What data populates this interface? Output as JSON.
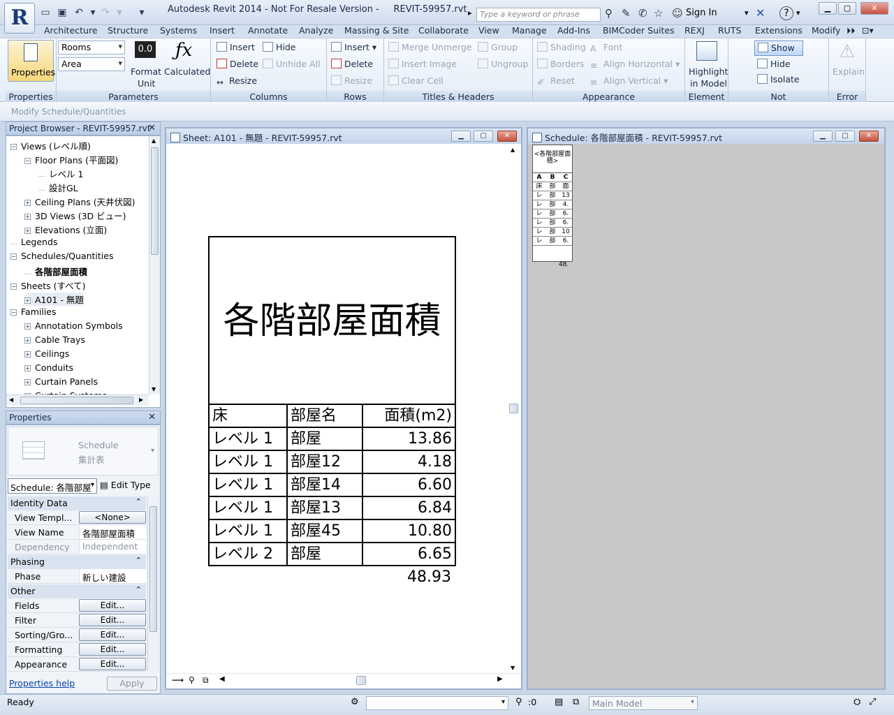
{
  "title": {
    "app": "Autodesk Revit 2014 - Not For Resale Version -",
    "file": "REVIT-59957.rvt"
  },
  "search": {
    "placeholder": "Type a keyword or phrase"
  },
  "signin": "Sign In",
  "ribbon_tabs": [
    "Architecture",
    "Structure",
    "Systems",
    "Insert",
    "Annotate",
    "Analyze",
    "Massing & Site",
    "Collaborate",
    "View",
    "Manage",
    "Add-Ins",
    "BIMCoder Suites",
    "REXJ",
    "RUTS",
    "Extensions",
    "Modify"
  ],
  "ribbon": {
    "properties": {
      "button": "Properties",
      "label": "Properties"
    },
    "parameters": {
      "label": "Parameters",
      "combo1": "Rooms",
      "combo2": "Area",
      "format_unit_icon": "0.0",
      "format_unit": "Format",
      "format_unit2": "Unit",
      "calculated": "Calculated"
    },
    "columns": {
      "label": "Columns",
      "insert": "Insert",
      "hide": "Hide",
      "delete": "Delete",
      "unhide": "Unhide  All",
      "resize": "Resize"
    },
    "rows": {
      "label": "Rows",
      "insert": "Insert",
      "delete": "Delete",
      "resize": "Resize"
    },
    "titles": {
      "label": "Titles & Headers",
      "merge": "Merge  Unmerge",
      "group": "Group",
      "insert_image": "Insert  Image",
      "ungroup": "Ungroup",
      "clear_cell": "Clear  Cell"
    },
    "appearance": {
      "label": "Appearance",
      "shading": "Shading",
      "font": "Font",
      "borders": "Borders",
      "align_h": "Align  Horizontal",
      "reset": "Reset",
      "align_v": "Align  Vertical"
    },
    "element": {
      "label": "Element",
      "highlight": "Highlight",
      "in_model": "in Model"
    },
    "not_placed": {
      "label": "Not Placed/Unenclosed",
      "show": "Show",
      "hide": "Hide",
      "isolate": "Isolate"
    },
    "error": {
      "label": "Error",
      "explain": "Explain"
    }
  },
  "context": "Modify Schedule/Quantities",
  "browser": {
    "title": "Project Browser - REVIT-59957.rvt",
    "items": [
      {
        "text": "Views (レベル順)",
        "level": 0,
        "toggle": "−"
      },
      {
        "text": "Floor Plans (平面図)",
        "level": 1,
        "toggle": "−"
      },
      {
        "text": "レベル 1",
        "level": 2,
        "toggle": ""
      },
      {
        "text": "設計GL",
        "level": 2,
        "toggle": ""
      },
      {
        "text": "Ceiling Plans (天井伏図)",
        "level": 1,
        "toggle": "+"
      },
      {
        "text": "3D Views (3D ビュー)",
        "level": 1,
        "toggle": "+"
      },
      {
        "text": "Elevations (立面)",
        "level": 1,
        "toggle": "+"
      },
      {
        "text": "Legends",
        "level": 0,
        "toggle": ""
      },
      {
        "text": "Schedules/Quantities",
        "level": 0,
        "toggle": "−"
      },
      {
        "text": "各階部屋面積",
        "level": 1,
        "toggle": ""
      },
      {
        "text": "Sheets (すべて)",
        "level": 0,
        "toggle": "−"
      },
      {
        "text": "A101 - 無題",
        "level": 1,
        "toggle": "+"
      },
      {
        "text": "Families",
        "level": 0,
        "toggle": "−"
      },
      {
        "text": "Annotation Symbols",
        "level": 1,
        "toggle": "+"
      },
      {
        "text": "Cable Trays",
        "level": 1,
        "toggle": "+"
      },
      {
        "text": "Ceilings",
        "level": 1,
        "toggle": "+"
      },
      {
        "text": "Conduits",
        "level": 1,
        "toggle": "+"
      },
      {
        "text": "Curtain Panels",
        "level": 1,
        "toggle": "+"
      },
      {
        "text": "Curtain Systems",
        "level": 1,
        "toggle": "+"
      }
    ]
  },
  "properties": {
    "title": "Properties",
    "type1": "Schedule",
    "type2": "集計表",
    "selector": "Schedule: 各階部屋",
    "edit_type": "Edit Type",
    "groups": {
      "identity": "Identity Data",
      "phasing": "Phasing",
      "other": "Other"
    },
    "rows": [
      {
        "k": "View Templ...",
        "v": "<None>",
        "btn": true
      },
      {
        "k": "View Name",
        "v": "各階部屋面積",
        "btn": false
      },
      {
        "k": "Dependency",
        "v": "Independent",
        "btn": false
      }
    ],
    "phase": {
      "k": "Phase",
      "v": "新しい建設"
    },
    "other_rows": [
      {
        "k": "Fields",
        "v": "Edit..."
      },
      {
        "k": "Filter",
        "v": "Edit..."
      },
      {
        "k": "Sorting/Gro...",
        "v": "Edit..."
      },
      {
        "k": "Formatting",
        "v": "Edit..."
      },
      {
        "k": "Appearance",
        "v": "Edit..."
      }
    ],
    "help": "Properties help",
    "apply": "Apply"
  },
  "sheet_window": {
    "title": "Sheet: A101 - 無題 - REVIT-59957.rvt"
  },
  "schedule_window": {
    "title": "Schedule: 各階部屋面積 - REVIT-59957.rvt"
  },
  "schedule": {
    "title": "各階部屋面積",
    "headers": [
      "床",
      "部屋名",
      "面積(m2)"
    ],
    "rows": [
      [
        "レベル 1",
        "部屋",
        "13.86"
      ],
      [
        "レベル 1",
        "部屋12",
        "4.18"
      ],
      [
        "レベル 1",
        "部屋14",
        "6.60"
      ],
      [
        "レベル 1",
        "部屋13",
        "6.84"
      ],
      [
        "レベル 1",
        "部屋45",
        "10.80"
      ],
      [
        "レベル 2",
        "部屋",
        "6.65"
      ]
    ],
    "total": "48.93"
  },
  "mini_schedule": {
    "title": "<各階部屋面積>",
    "cols": [
      "A",
      "B",
      "C"
    ],
    "header": [
      "床",
      "部",
      "面"
    ],
    "rows": [
      [
        "レ",
        "部",
        "13"
      ],
      [
        "レ",
        "部",
        "4."
      ],
      [
        "レ",
        "部",
        "6."
      ],
      [
        "レ",
        "部",
        "6."
      ],
      [
        "レ",
        "部",
        "10"
      ],
      [
        "レ",
        "部",
        "6."
      ]
    ],
    "total": "48."
  },
  "status": {
    "text": "Ready",
    "filter_count": ":0",
    "model": "Main Model"
  }
}
